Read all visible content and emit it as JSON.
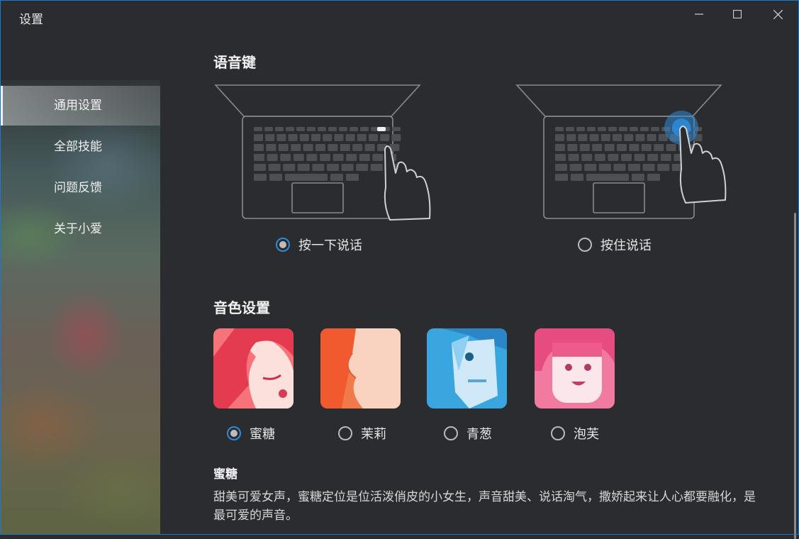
{
  "window": {
    "title": "设置"
  },
  "sidebar": {
    "items": [
      {
        "label": "通用设置",
        "active": true
      },
      {
        "label": "全部技能",
        "active": false
      },
      {
        "label": "问题反馈",
        "active": false
      },
      {
        "label": "关于小爱",
        "active": false
      }
    ]
  },
  "controls": {
    "minimize": "minimize-icon",
    "maximize": "maximize-icon",
    "close": "close-icon"
  },
  "voice_key": {
    "title": "语音键",
    "options": [
      {
        "label": "按一下说话",
        "checked": true
      },
      {
        "label": "按住说话",
        "checked": false
      }
    ]
  },
  "timbre": {
    "title": "音色设置",
    "options": [
      {
        "label": "蜜糖",
        "checked": true,
        "color": "#f2636e"
      },
      {
        "label": "茉莉",
        "checked": false,
        "color": "#f07a4a"
      },
      {
        "label": "青葱",
        "checked": false,
        "color": "#3aa6e0"
      },
      {
        "label": "泡芙",
        "checked": false,
        "color": "#f279a0"
      }
    ],
    "selected_name": "蜜糖",
    "selected_desc": "甜美可爱女声，蜜糖定位是位活泼俏皮的小女生，声音甜美、说话淘气，撒娇起来让人心都要融化，是最可爱的声音。"
  },
  "colors": {
    "accent": "#2f8ad6",
    "background": "#2b2c30"
  }
}
